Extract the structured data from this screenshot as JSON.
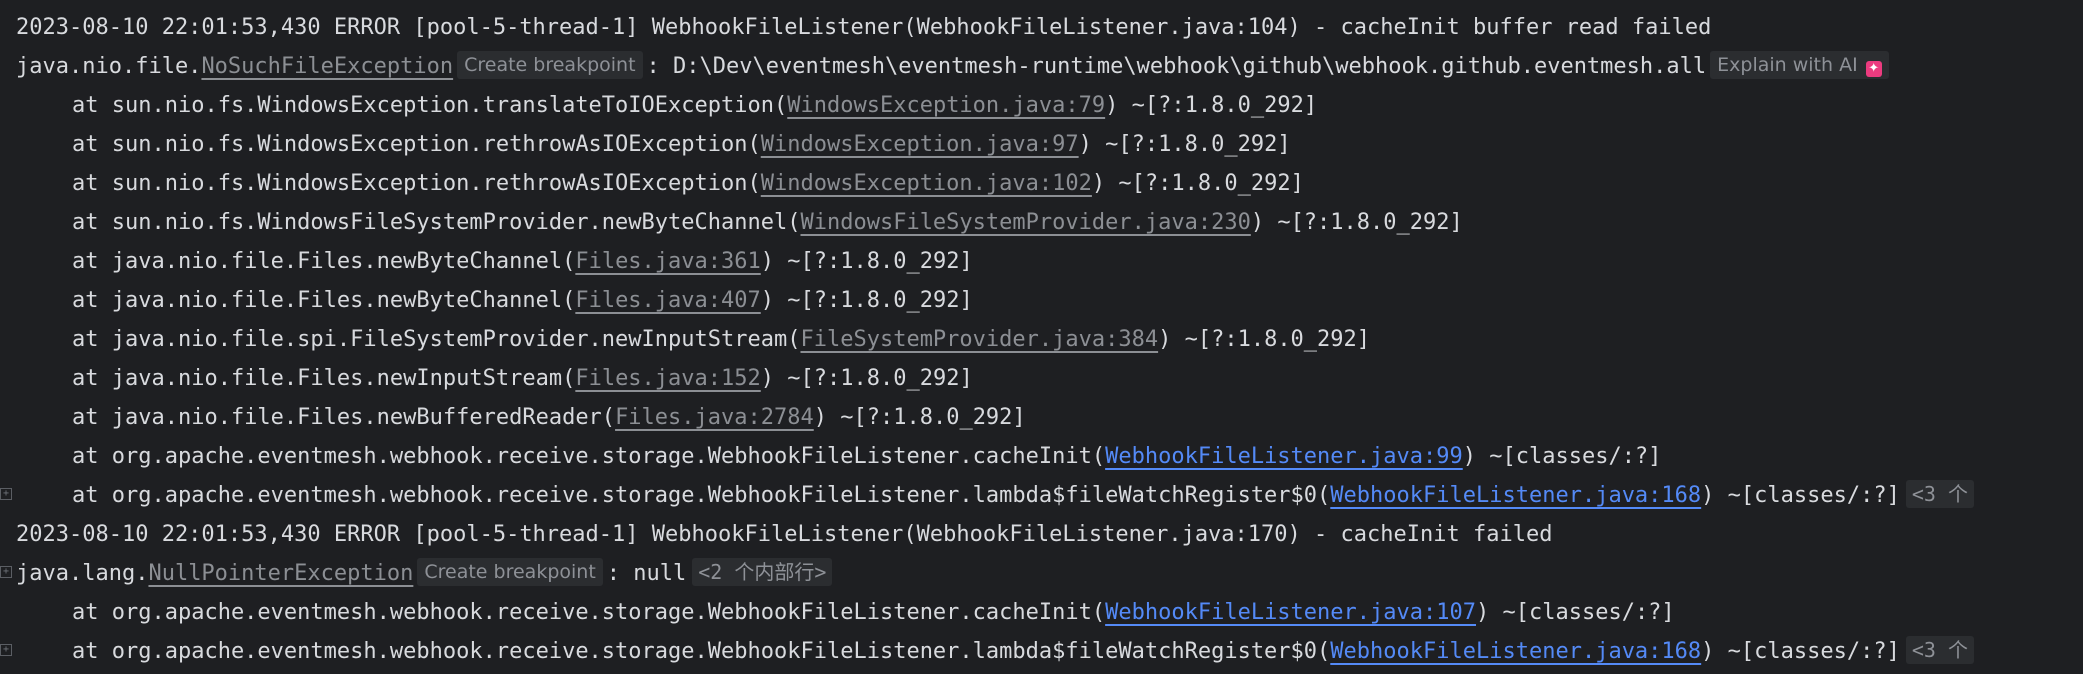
{
  "lines": [
    {
      "text": "2023-08-10 22:01:53,430 ERROR [pool-5-thread-1] WebhookFileListener(WebhookFileListener.java:104) - cacheInit buffer read failed"
    },
    {
      "prefix": "java.nio.file.",
      "exception": "NoSuchFileException",
      "breakpoint": "Create breakpoint",
      "suffix": ": D:\\Dev\\eventmesh\\eventmesh-runtime\\webhook\\github\\webhook.github.eventmesh.all",
      "ai_label": "Explain with AI"
    },
    {
      "pre": "at sun.nio.fs.WindowsException.translateToIOException(",
      "link": "WindowsException.java:79",
      "post": ") ~[?:1.8.0_292]"
    },
    {
      "pre": "at sun.nio.fs.WindowsException.rethrowAsIOException(",
      "link": "WindowsException.java:97",
      "post": ") ~[?:1.8.0_292]"
    },
    {
      "pre": "at sun.nio.fs.WindowsException.rethrowAsIOException(",
      "link": "WindowsException.java:102",
      "post": ") ~[?:1.8.0_292]"
    },
    {
      "pre": "at sun.nio.fs.WindowsFileSystemProvider.newByteChannel(",
      "link": "WindowsFileSystemProvider.java:230",
      "post": ") ~[?:1.8.0_292]"
    },
    {
      "pre": "at java.nio.file.Files.newByteChannel(",
      "link": "Files.java:361",
      "post": ") ~[?:1.8.0_292]"
    },
    {
      "pre": "at java.nio.file.Files.newByteChannel(",
      "link": "Files.java:407",
      "post": ") ~[?:1.8.0_292]"
    },
    {
      "pre": "at java.nio.file.spi.FileSystemProvider.newInputStream(",
      "link": "FileSystemProvider.java:384",
      "post": ") ~[?:1.8.0_292]"
    },
    {
      "pre": "at java.nio.file.Files.newInputStream(",
      "link": "Files.java:152",
      "post": ") ~[?:1.8.0_292]"
    },
    {
      "pre": "at java.nio.file.Files.newBufferedReader(",
      "link": "Files.java:2784",
      "post": ") ~[?:1.8.0_292]"
    },
    {
      "pre": "at org.apache.eventmesh.webhook.receive.storage.WebhookFileListener.cacheInit(",
      "link": "WebhookFileListener.java:99",
      "post": ") ~[classes/:?]"
    },
    {
      "pre": "at org.apache.eventmesh.webhook.receive.storage.WebhookFileListener.lambda$fileWatchRegister$0(",
      "link": "WebhookFileListener.java:168",
      "post": ") ~[classes/:?]",
      "fold": "<3 个"
    },
    {
      "text": "2023-08-10 22:01:53,430 ERROR [pool-5-thread-1] WebhookFileListener(WebhookFileListener.java:170) - cacheInit failed"
    },
    {
      "prefix": "java.lang.",
      "exception": "NullPointerException",
      "breakpoint": "Create breakpoint",
      "suffix": ": null",
      "fold": "<2 个内部行>"
    },
    {
      "pre": "at org.apache.eventmesh.webhook.receive.storage.WebhookFileListener.cacheInit(",
      "link": "WebhookFileListener.java:107",
      "post": ") ~[classes/:?]"
    },
    {
      "pre": "at org.apache.eventmesh.webhook.receive.storage.WebhookFileListener.lambda$fileWatchRegister$0(",
      "link": "WebhookFileListener.java:168",
      "post": ") ~[classes/:?]",
      "fold": "<3 个"
    }
  ]
}
